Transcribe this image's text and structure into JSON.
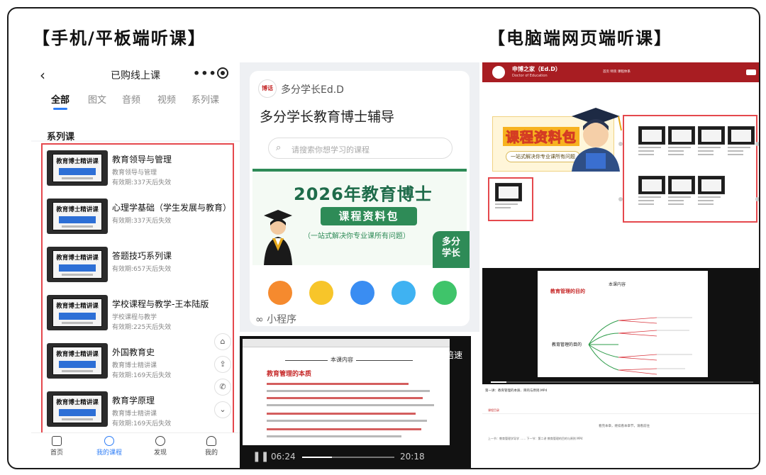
{
  "titles": {
    "left": "【手机/平板端听课】",
    "right": "【电脑端网页端听课】"
  },
  "phone_app": {
    "back_icon": "chevron-left-icon",
    "header_title": "已购线上课",
    "more_icon": "more-dots-icon",
    "record_icon": "record-icon",
    "tabs": [
      "全部",
      "图文",
      "音频",
      "视频",
      "系列课"
    ],
    "active_tab": "全部",
    "section_label": "系列课",
    "thumb_label": "教育博士精讲课",
    "courses": [
      {
        "name": "教育领导与管理",
        "sub": "教育领导与管理",
        "validity": "有效期:337天后失效"
      },
      {
        "name": "心理学基础（学生发展与教育）",
        "sub": "",
        "validity": "有效期:337天后失效"
      },
      {
        "name": "答题技巧系列课",
        "sub": "",
        "validity": "有效期:657天后失效"
      },
      {
        "name": "学校课程与教学-王本陆版",
        "sub": "学校课程与教学",
        "validity": "有效期:225天后失效"
      },
      {
        "name": "外国教育史",
        "sub": "教育博士精讲课",
        "validity": "有效期:169天后失效"
      },
      {
        "name": "教育学原理",
        "sub": "教育博士精讲课",
        "validity": "有效期:169天后失效"
      }
    ],
    "side_icons": [
      "home-icon",
      "share-icon",
      "phone-icon",
      "chevron-down-icon"
    ],
    "bottom_nav": [
      {
        "label": "首页",
        "icon": "home-icon"
      },
      {
        "label": "我的课程",
        "icon": "course-icon",
        "active": true
      },
      {
        "label": "发现",
        "icon": "discover-icon"
      },
      {
        "label": "我的",
        "icon": "user-icon"
      }
    ],
    "accent_color": "#2d7df6",
    "highlight_color": "#e5484d"
  },
  "mini_program": {
    "logo_text": "博话",
    "brand": "多分学长Ed.D",
    "heading": "多分学长教育博士辅导",
    "search_placeholder": "请搜索你想学习的课程",
    "banner": {
      "title": "2026年教育博士",
      "pill": "课程资料包",
      "subtitle": "（一站式解决你专业课所有问题）",
      "badge_line1": "多分",
      "badge_line2": "学长"
    },
    "footer_label": "小程序",
    "brand_green": "#2e8b57"
  },
  "phone_video": {
    "speed_label": "倍速",
    "doc_center_label": "本课内容",
    "doc_heading": "教育管理的本质",
    "time_current": "06:24",
    "time_total": "20:18",
    "progress_fraction": 0.32
  },
  "website": {
    "site_name": "申博之家（Ed.D）",
    "site_sub": "Doctor of Education",
    "nav_links": "首页    师资    课程体系",
    "banner_title": "课程资料包",
    "banner_sub": "一站式解决你专业课所有问题",
    "brand_red": "#a81d22"
  },
  "website_video": {
    "center_label": "本课内容",
    "heading": "教育管理的目的",
    "mind_center": "教育管理的目的",
    "caption": "第一讲：教育管理的本质、目的与原则.MP4",
    "tab": "课程目录",
    "next_prompt": "看完本章，继续看本章节，请看前往",
    "row_text": "上一节：教育管理学导学 ……  下一节：第二讲 教育管理的目的与原则 MP4",
    "progress_fraction": 0.06
  }
}
